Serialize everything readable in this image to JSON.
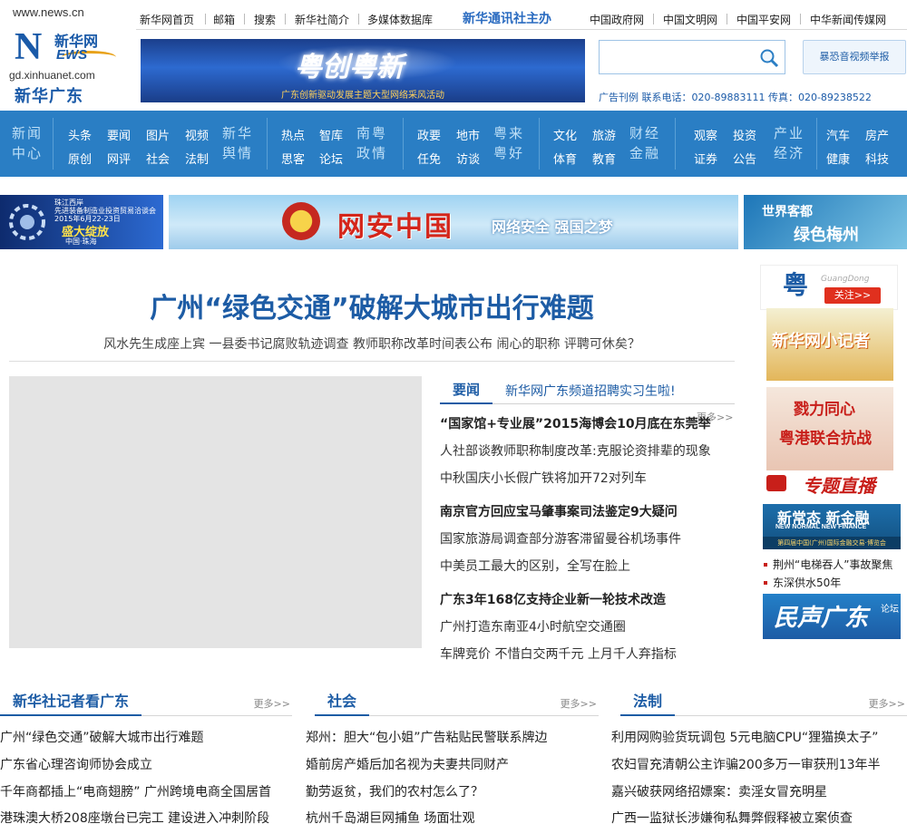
{
  "logo": {
    "domain": "www.news.cn",
    "brand_cn": "新华网",
    "news_letters": "NEWS",
    "domain2": "gd.xinhuanet.com",
    "channel": "新华广东"
  },
  "top_nav": {
    "items": [
      "新华网首页",
      "邮箱",
      "搜索",
      "新华社简介",
      "多媒体数据库"
    ],
    "brand": "新华通讯社主办",
    "right_items": [
      "中国政府网",
      "中国文明网",
      "中国平安网",
      "中华新闻传媒网"
    ]
  },
  "banner": {
    "calligraphy": "粤创粤新",
    "subtitle": "广东创新驱动发展主题大型网络采风活动"
  },
  "search": {
    "placeholder": "",
    "icon": "search-icon"
  },
  "report_button": "暴恐音视频举报",
  "ad_line": "广告刊例  联系电话：020-89883111  传真：020-89238522",
  "main_nav": {
    "groups": [
      {
        "title": "新闻中心",
        "links": [
          [
            "头条",
            "要闻",
            "图片",
            "视频"
          ],
          [
            "原创",
            "网评",
            "社会",
            "法制"
          ]
        ]
      },
      {
        "title": "新华舆情",
        "links": [
          [
            "热点",
            "智库"
          ],
          [
            "思客",
            "论坛"
          ]
        ]
      },
      {
        "title": "南粤政情",
        "links": [
          [
            "政要",
            "地市"
          ],
          [
            "任免",
            "访谈"
          ]
        ]
      },
      {
        "title": "粤来粤好",
        "links": [
          [
            "文化",
            "旅游"
          ],
          [
            "体育",
            "教育"
          ]
        ]
      },
      {
        "title": "财经金融",
        "links": [
          [
            "观察",
            "投资"
          ],
          [
            "证券",
            "公告"
          ]
        ]
      },
      {
        "title": "产业经济",
        "links": [
          [
            "汽车",
            "房产"
          ],
          [
            "健康",
            "科技"
          ]
        ]
      }
    ]
  },
  "promos": {
    "left_lines": [
      "珠江西岸",
      "先进装备制造业投资贸易洽谈会",
      "2015年6月22-23日"
    ],
    "left_title": "盛大绽放",
    "left_sub": "中国·珠海",
    "center_title": "网安中国",
    "center_slogan": "网络安全 强国之梦",
    "right_top": "世界客都",
    "right_bottom": "绿色梅州"
  },
  "headline": "广州“绿色交通”破解大城市出行难题",
  "subheads": [
    "风水先生成座上宾",
    "一县委书记腐败轨迹调查",
    "教师职称改革时间表公布",
    "闹心的职称 评聘可休矣？"
  ],
  "news_tabs": {
    "active": "要闻",
    "promo": "新华网广东频道招聘实习生啦!"
  },
  "more_label": "更多>>",
  "news_list": [
    {
      "text": "“国家馆+专业展”2015海博会10月底在东莞举",
      "bold": true
    },
    {
      "text": "人社部谈教师职称制度改革:克服论资排辈的现象",
      "bold": false
    },
    {
      "text": "中秋国庆小长假广铁将加开72对列车",
      "bold": false
    },
    {
      "text": "南京官方回应宝马肇事案司法鉴定9大疑问",
      "bold": true
    },
    {
      "text": "国家旅游局调查部分游客滞留曼谷机场事件",
      "bold": false
    },
    {
      "text": "中美员工最大的区别，全写在脸上",
      "bold": false
    },
    {
      "text": "广东3年168亿支持企业新一轮技术改造",
      "bold": true
    },
    {
      "text": "广州打造东南亚4小时航空交通圈",
      "bold": false
    },
    {
      "text": "车牌竞价  不惜白交两千元  上月千人弃指标",
      "bold": false
    }
  ],
  "right_col": {
    "yue": "粤",
    "yue_en": "GuangDong",
    "follow": "关注>>",
    "kids": "新华网小记者",
    "hk_1": "戮力同心",
    "hk_2": "粤港联合抗战",
    "live": "专题直播",
    "finance_title": "新常态  新金融",
    "finance_en": "NEW NORMAL  NEW FINANCE",
    "finance_sub": "第四届中国(广州)国际金融交易·博览会",
    "links": [
      "荆州“电梯吞人”事故聚焦",
      "东深供水50年"
    ],
    "forum": "民声广东",
    "forum_tag": "论坛"
  },
  "sections": [
    {
      "title": "新华社记者看广东",
      "items": [
        "广州“绿色交通”破解大城市出行难题",
        "广东省心理咨询师协会成立",
        "千年商都插上“电商翅膀” 广州跨境电商全国居首",
        "港珠澳大桥208座墩台已完工  建设进入冲刺阶段"
      ]
    },
    {
      "title": "社会",
      "items": [
        "郑州：胆大“包小姐”广告粘贴民警联系牌边",
        "婚前房产婚后加名视为夫妻共同财产",
        "勤劳返贫，我们的农村怎么了？",
        "杭州千岛湖巨网捕鱼  场面壮观"
      ]
    },
    {
      "title": "法制",
      "items": [
        "利用网购验货玩调包  5元电脑CPU“狸猫换太子”",
        "农妇冒充清朝公主诈骗200多万一审获刑13年半",
        "嘉兴破获网络招嫖案：卖淫女冒充明星",
        "广西一监狱长涉嫌徇私舞弊假释被立案侦查"
      ]
    }
  ]
}
